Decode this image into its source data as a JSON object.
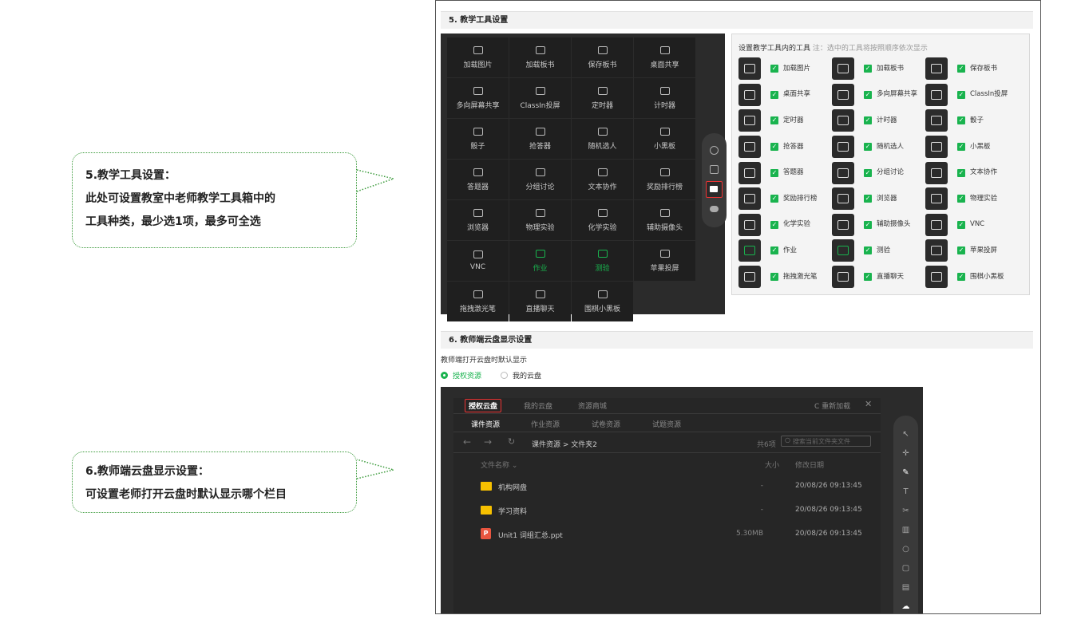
{
  "callouts": [
    {
      "line1": "5.教学工具设置：",
      "line2": "此处可设置教室中老师教学工具箱中的",
      "line3": "工具种类，最少选1项，最多可全选"
    },
    {
      "line1": "6.教师端云盘显示设置：",
      "line2": "可设置老师打开云盘时默认显示哪个栏目"
    }
  ],
  "section5": {
    "title": "5. 教学工具设置",
    "toolbox": [
      {
        "label": "加载图片",
        "green": false
      },
      {
        "label": "加载板书",
        "green": false
      },
      {
        "label": "保存板书",
        "green": false
      },
      {
        "label": "桌面共享",
        "green": false
      },
      {
        "label": "多向屏幕共享",
        "green": false
      },
      {
        "label": "ClassIn投屏",
        "green": false
      },
      {
        "label": "定时器",
        "green": false
      },
      {
        "label": "计时器",
        "green": false
      },
      {
        "label": "骰子",
        "green": false
      },
      {
        "label": "抢答器",
        "green": false
      },
      {
        "label": "随机选人",
        "green": false
      },
      {
        "label": "小黑板",
        "green": false
      },
      {
        "label": "答题器",
        "green": false
      },
      {
        "label": "分组讨论",
        "green": false
      },
      {
        "label": "文本协作",
        "green": false
      },
      {
        "label": "奖励排行榜",
        "green": false
      },
      {
        "label": "浏览器",
        "green": false
      },
      {
        "label": "物理实验",
        "green": false
      },
      {
        "label": "化学实验",
        "green": false
      },
      {
        "label": "辅助摄像头",
        "green": false
      },
      {
        "label": "VNC",
        "green": false
      },
      {
        "label": "作业",
        "green": true
      },
      {
        "label": "测验",
        "green": true
      },
      {
        "label": "苹果投屏",
        "green": false
      },
      {
        "label": "拖拽激光笔",
        "green": false
      },
      {
        "label": "直播聊天",
        "green": false
      },
      {
        "label": "围棋小黑板",
        "green": false
      }
    ],
    "panel_title": "设置教学工具内的工具",
    "panel_note": "注：选中的工具将按照顺序依次显示",
    "items": [
      {
        "label": "加载图片",
        "green": false
      },
      {
        "label": "加载板书",
        "green": false
      },
      {
        "label": "保存板书",
        "green": false
      },
      {
        "label": "桌面共享",
        "green": false
      },
      {
        "label": "多向屏幕共享",
        "green": false
      },
      {
        "label": "ClassIn投屏",
        "green": false
      },
      {
        "label": "定时器",
        "green": false
      },
      {
        "label": "计时器",
        "green": false
      },
      {
        "label": "骰子",
        "green": false
      },
      {
        "label": "抢答器",
        "green": false
      },
      {
        "label": "随机选人",
        "green": false
      },
      {
        "label": "小黑板",
        "green": false
      },
      {
        "label": "答题器",
        "green": false
      },
      {
        "label": "分组讨论",
        "green": false
      },
      {
        "label": "文本协作",
        "green": false
      },
      {
        "label": "奖励排行榜",
        "green": false
      },
      {
        "label": "浏览器",
        "green": false
      },
      {
        "label": "物理实验",
        "green": false
      },
      {
        "label": "化学实验",
        "green": false
      },
      {
        "label": "辅助摄像头",
        "green": false
      },
      {
        "label": "VNC",
        "green": false
      },
      {
        "label": "作业",
        "green": true
      },
      {
        "label": "测验",
        "green": true
      },
      {
        "label": "苹果投屏",
        "green": false
      },
      {
        "label": "拖拽激光笔",
        "green": false
      },
      {
        "label": "直播聊天",
        "green": false
      },
      {
        "label": "围棋小黑板",
        "green": false
      }
    ]
  },
  "section6": {
    "title": "6. 教师端云盘显示设置",
    "hint": "教师端打开云盘时默认显示",
    "options": [
      "授权资源",
      "我的云盘"
    ],
    "selected": "授权资源",
    "cloud": {
      "tabs": [
        "授权云盘",
        "我的云盘",
        "资源商城"
      ],
      "reload": "C 重新加载",
      "subtabs": [
        "课件资源",
        "作业资源",
        "试卷资源",
        "试题资源"
      ],
      "path": "课件资源 > 文件夹2",
      "count": "共6项",
      "search_placeholder": "搜索当前文件夹文件",
      "columns": [
        "文件名称",
        "大小",
        "修改日期"
      ],
      "files": [
        {
          "name": "机构网盘",
          "size": "-",
          "date": "20/08/26 09:13:45",
          "type": "folder"
        },
        {
          "name": "学习资料",
          "size": "-",
          "date": "20/08/26 09:13:45",
          "type": "folder"
        },
        {
          "name": "Unit1 词组汇总.ppt",
          "size": "5.30MB",
          "date": "20/08/26 09:13:45",
          "type": "ppt"
        }
      ]
    }
  },
  "colors": {
    "accent": "#19b34e",
    "highlight": "#e33333",
    "dark": "#2b2b2b"
  }
}
